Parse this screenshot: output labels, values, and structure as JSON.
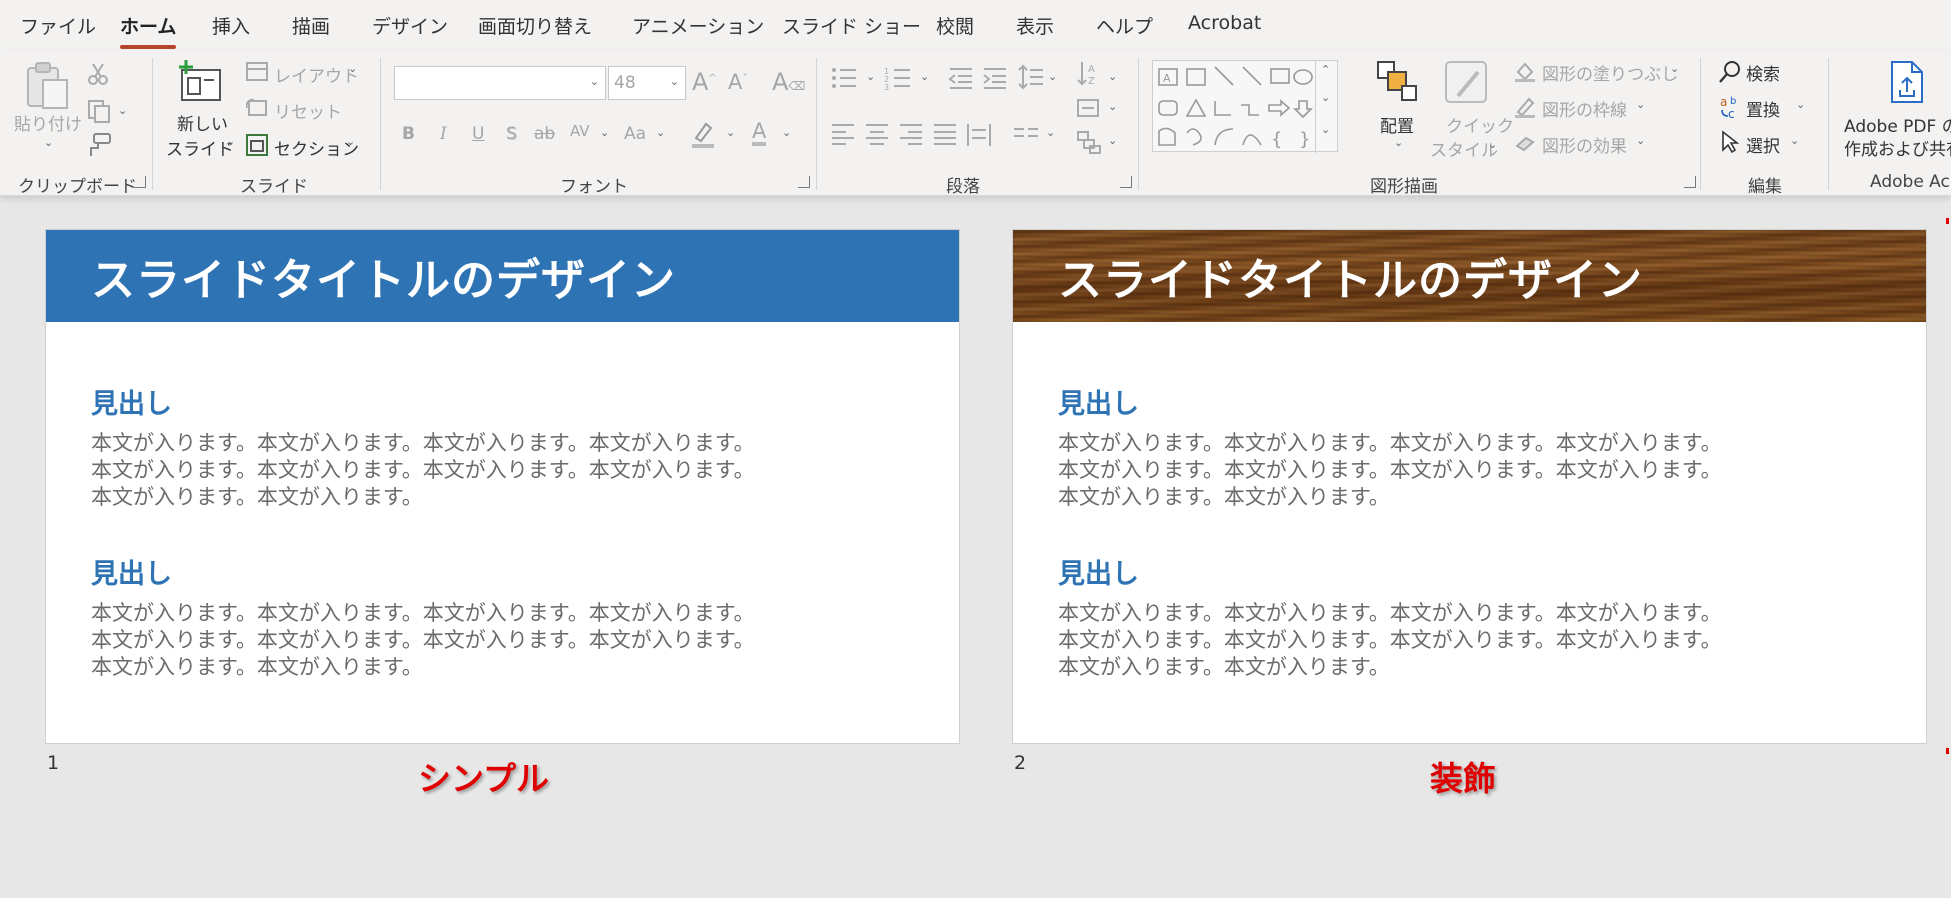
{
  "menu": {
    "tabs": [
      "ファイル",
      "ホーム",
      "挿入",
      "描画",
      "デザイン",
      "画面切り替え",
      "アニメーション",
      "スライド ショー",
      "校閲",
      "表示",
      "ヘルプ",
      "Acrobat"
    ],
    "active": "ホーム"
  },
  "ribbon": {
    "clipboard": {
      "paste": "貼り付け",
      "label": "クリップボード"
    },
    "slides": {
      "new_slide_line1": "新しい",
      "new_slide_line2": "スライド",
      "layout": "レイアウト",
      "reset": "リセット",
      "section": "セクション",
      "label": "スライド"
    },
    "font": {
      "font_name": "",
      "font_size": "48",
      "bold": "B",
      "italic": "I",
      "underline": "U",
      "shadow": "S",
      "strike": "ab",
      "spacing": "AV",
      "case": "Aa",
      "color": "A",
      "label": "フォント"
    },
    "paragraph": {
      "label": "段落"
    },
    "drawing": {
      "arrange": "配置",
      "quick_line1": "クイック",
      "quick_line2": "スタイル",
      "fill": "図形の塗りつぶし",
      "outline": "図形の枠線",
      "effects": "図形の効果",
      "label": "図形描画"
    },
    "editing": {
      "find": "検索",
      "replace": "置換",
      "select": "選択",
      "label": "編集"
    },
    "adobe": {
      "line1": "Adobe PDF の",
      "line2": "作成および共有",
      "label": "Adobe Ac"
    }
  },
  "slides": [
    {
      "number": "1",
      "title": "スライドタイトルのデザイン",
      "style": "blue",
      "caption": "シンプル",
      "sections": [
        {
          "heading": "見出し",
          "lines": [
            "本文が入ります。本文が入ります。本文が入ります。本文が入ります。",
            "本文が入ります。本文が入ります。本文が入ります。本文が入ります。",
            "本文が入ります。本文が入ります。"
          ]
        },
        {
          "heading": "見出し",
          "lines": [
            "本文が入ります。本文が入ります。本文が入ります。本文が入ります。",
            "本文が入ります。本文が入ります。本文が入ります。本文が入ります。",
            "本文が入ります。本文が入ります。"
          ]
        }
      ]
    },
    {
      "number": "2",
      "title": "スライドタイトルのデザイン",
      "style": "wood",
      "caption": "装飾",
      "sections": [
        {
          "heading": "見出し",
          "lines": [
            "本文が入ります。本文が入ります。本文が入ります。本文が入ります。",
            "本文が入ります。本文が入ります。本文が入ります。本文が入ります。",
            "本文が入ります。本文が入ります。"
          ]
        },
        {
          "heading": "見出し",
          "lines": [
            "本文が入ります。本文が入ります。本文が入ります。本文が入ります。",
            "本文が入ります。本文が入ります。本文が入ります。本文が入ります。",
            "本文が入ります。本文が入ります。"
          ]
        }
      ]
    }
  ],
  "colors": {
    "accent": "#2e74b5",
    "tab_underline": "#b7472a",
    "caption": "#e00000"
  }
}
